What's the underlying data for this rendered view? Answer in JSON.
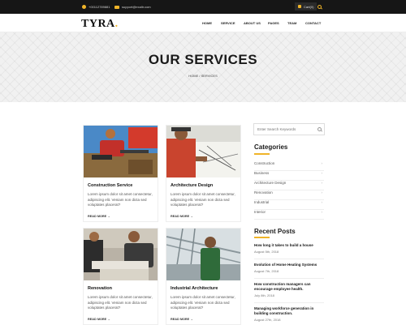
{
  "topbar": {
    "phone": "+00112789881",
    "email": "support@exaltr.com",
    "cart": "Cart(0)"
  },
  "brand": {
    "name": "TYRA",
    "dot": "."
  },
  "nav": {
    "items": [
      "HOME",
      "SERVICE",
      "ABOUT US",
      "PAGES",
      "TEAM",
      "CONTACT"
    ]
  },
  "banner": {
    "title": "OUR SERVICES",
    "breadcrumb": "HOME / SERVICES"
  },
  "cards": [
    {
      "title": "Construction Service",
      "desc": "Lorem ipsum dolor sit amet consectetur, adipiscing elit. Veniam non dicta sed voluptates placerat?",
      "more": "READ MORE →"
    },
    {
      "title": "Architecture Design",
      "desc": "Lorem ipsum dolor sit amet consectetur, adipiscing elit. Veniam non dicta sed voluptates placerat?",
      "more": "READ MORE →"
    },
    {
      "title": "Renovation",
      "desc": "Lorem ipsum dolor sit amet consectetur, adipiscing elit. Veniam non dicta sed voluptates placerat?",
      "more": "READ MORE →"
    },
    {
      "title": "Industrial Architecture",
      "desc": "Lorem ipsum dolor sit amet consectetur, adipiscing elit. Veniam non dicta sed voluptates placerat?",
      "more": "READ MORE →"
    }
  ],
  "sidebar": {
    "search_placeholder": "Enter Search Keywords",
    "categories_title": "Categories",
    "categories": [
      "Construction",
      "Business",
      "Architecture Design",
      "Renovation",
      "Industrial",
      "Interior"
    ],
    "recent_title": "Recent Posts",
    "posts": [
      {
        "title": "How long it takes to build a house",
        "date": "August 5th, 2018"
      },
      {
        "title": "Evolution of Home Heating Systems",
        "date": "August 7th, 2018"
      },
      {
        "title": "How construction managers can encourage employee health.",
        "date": "July 8th, 2018"
      },
      {
        "title": "Managing workforce generation in building construction.",
        "date": "August 27th, 2018"
      }
    ]
  },
  "colors": {
    "accent": "#f0b429",
    "topbar": "#161616"
  }
}
